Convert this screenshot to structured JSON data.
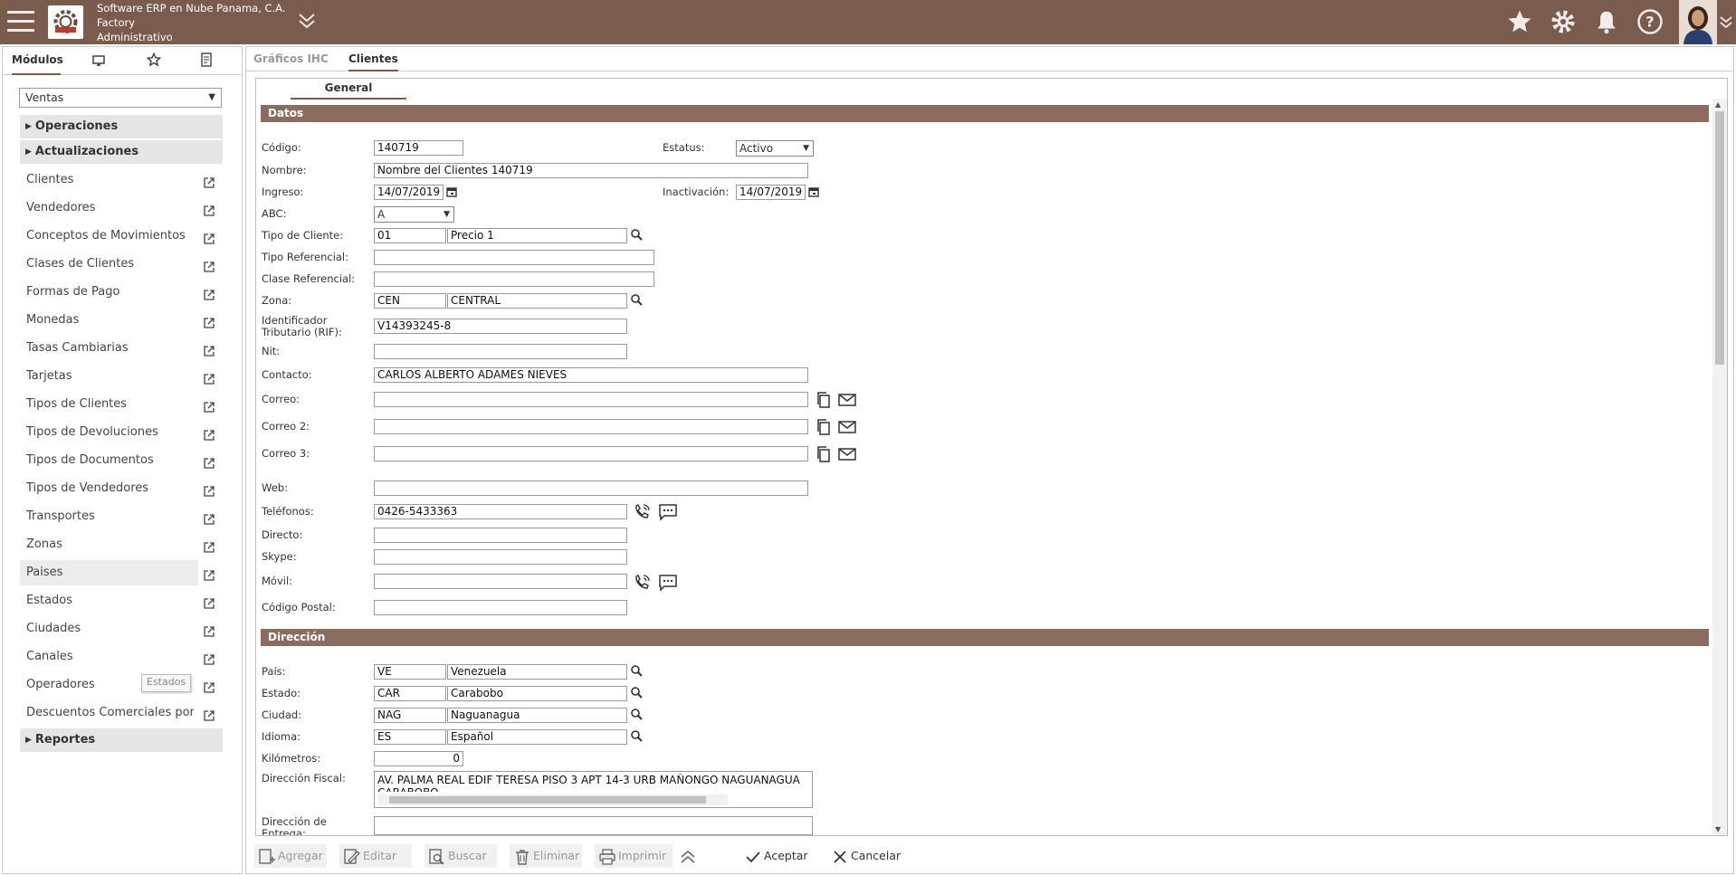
{
  "header": {
    "company_line1": "Software ERP en Nube Panama, C.A.",
    "company_line2": "Factory",
    "company_line3": "Administrativo"
  },
  "sidebar": {
    "tabs": [
      "Módulos"
    ],
    "module_select": "Ventas",
    "sections": {
      "operaciones": "Operaciones",
      "actualizaciones": "Actualizaciones",
      "reportes": "Reportes"
    },
    "items": [
      "Clientes",
      "Vendedores",
      "Conceptos de Movimientos",
      "Clases de Clientes",
      "Formas de Pago",
      "Monedas",
      "Tasas Cambiarias",
      "Tarjetas",
      "Tipos de Clientes",
      "Tipos de Devoluciones",
      "Tipos de Documentos",
      "Tipos de Vendedores",
      "Transportes",
      "Zonas",
      "Paises",
      "Estados",
      "Ciudades",
      "Canales",
      "Operadores",
      "Descuentos Comerciales por Volumen"
    ],
    "tooltip": "Estados"
  },
  "tabs": {
    "graficos": "Gráficos IHC",
    "clientes": "Clientes"
  },
  "form": {
    "subtab": "General",
    "section_datos": "Datos",
    "section_direccion": "Dirección",
    "labels": {
      "codigo": "Código:",
      "estatus": "Estatus:",
      "nombre": "Nombre:",
      "ingreso": "Ingreso:",
      "inactivacion": "Inactivación:",
      "abc": "ABC:",
      "tipo_cliente": "Tipo de Cliente:",
      "tipo_ref": "Tipo Referencial:",
      "clase_ref": "Clase Referencial:",
      "zona": "Zona:",
      "rif": "Identificador Tributario (RIF):",
      "nit": "Nit:",
      "contacto": "Contacto:",
      "correo": "Correo:",
      "correo2": "Correo 2:",
      "correo3": "Correo 3:",
      "web": "Web:",
      "telefonos": "Teléfonos:",
      "directo": "Directo:",
      "skype": "Skype:",
      "movil": "Móvil:",
      "codigo_postal": "Código Postal:",
      "pais": "País:",
      "estado": "Estado:",
      "ciudad": "Ciudad:",
      "idioma": "Idioma:",
      "kilometros": "Kilómetros:",
      "dir_fiscal": "Dirección Fiscal:",
      "dir_entrega": "Dirección de Entrega:"
    },
    "values": {
      "codigo": "140719",
      "estatus": "Activo",
      "nombre": "Nombre del Clientes 140719",
      "ingreso": "14/07/2019",
      "inactivacion": "14/07/2019",
      "abc": "A",
      "tipo_cliente_code": "01",
      "tipo_cliente_desc": "Precio 1",
      "zona_code": "CEN",
      "zona_desc": "CENTRAL",
      "rif": "V14393245-8",
      "contacto": "CARLOS ALBERTO ADAMES NIEVES",
      "telefonos": "0426-5433363",
      "pais_code": "VE",
      "pais_desc": "Venezuela",
      "estado_code": "CAR",
      "estado_desc": "Carabobo",
      "ciudad_code": "NAG",
      "ciudad_desc": "Naguanagua",
      "idioma_code": "ES",
      "idioma_desc": "Español",
      "kilometros": "0",
      "dir_fiscal": "AV. PALMA REAL EDIF TERESA PISO 3 APT 14-3 URB MAÑONGO NAGUANAGUA CARABOBO"
    }
  },
  "toolbar": {
    "agregar": "Agregar",
    "editar": "Editar",
    "buscar": "Buscar",
    "eliminar": "Eliminar",
    "imprimir": "Imprimir",
    "aceptar": "Aceptar",
    "cancelar": "Cancelar"
  },
  "colors": {
    "header_bg": "#7a5c4e",
    "section_bg": "#8a6d5f"
  }
}
